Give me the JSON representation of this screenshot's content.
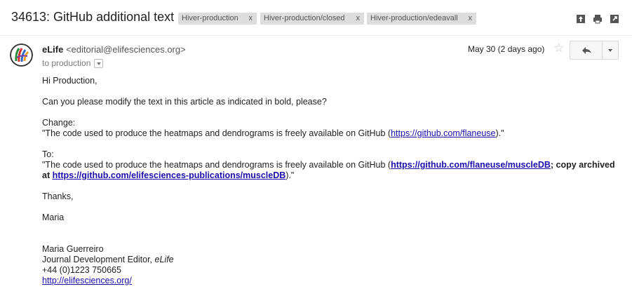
{
  "subject": "34613: GitHub additional text",
  "labels": [
    {
      "name": "Hiver-production",
      "remove": "x"
    },
    {
      "name": "Hiver-production/closed",
      "remove": "x"
    },
    {
      "name": "Hiver-production/edeavall",
      "remove": "x"
    }
  ],
  "toolbar": {
    "icons": [
      "expand-all-icon",
      "print-icon",
      "new-window-icon"
    ]
  },
  "message": {
    "sender_name": "eLife",
    "sender_email": "<editorial@elifesciences.org>",
    "to": "to production",
    "date": "May 30 (2 days ago)",
    "body": {
      "greeting": "Hi Production,",
      "request": "Can you please modify the text in this article as indicated in bold, please?",
      "change_label": "Change:",
      "change_pre": "\"The code used to produce the heatmaps and dendrograms is freely available on GitHub (",
      "change_link": "https://github.com/flaneuse",
      "change_post": ").\"",
      "to_label": "To:",
      "to_pre": "\"The code used to produce the heatmaps and dendrograms is freely available on GitHub (",
      "to_link1": "https://github.com/flaneuse/muscleDB",
      "to_mid": "; copy archived at ",
      "to_link2": "https://github.com/elifesciences-publications/muscleDB",
      "to_post": ").\"",
      "thanks": "Thanks,",
      "signoff": "Maria",
      "sig_name": "Maria Guerreiro",
      "sig_title": "Journal Development Editor, ",
      "sig_title_italic": "eLife",
      "sig_phone": "+44 (0)1223 750665",
      "sig_url": "http://elifesciences.org/"
    }
  },
  "colors": {
    "link": "#1a0dab",
    "label_bg": "#dddddd"
  }
}
